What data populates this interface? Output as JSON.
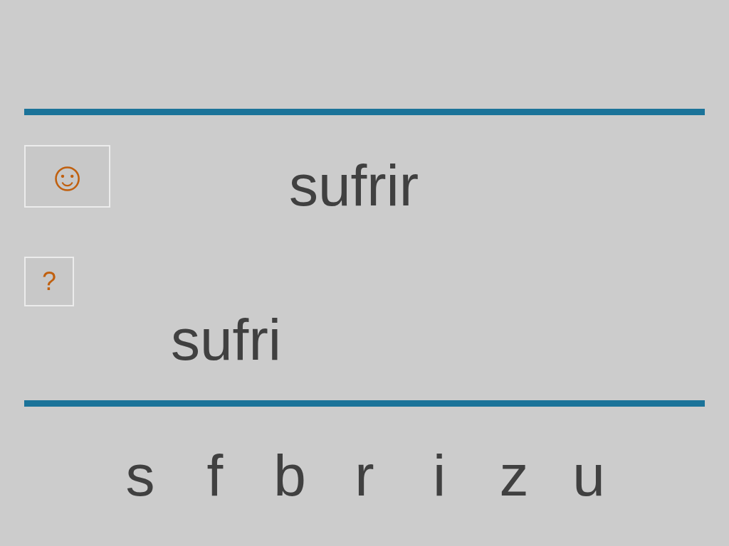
{
  "hint_button": {
    "label": "☺"
  },
  "prompt": "sufrir",
  "help_button": {
    "label": "?"
  },
  "answer": "sufri",
  "letters": [
    "s",
    "f",
    "b",
    "r",
    "i",
    "z",
    "u"
  ]
}
